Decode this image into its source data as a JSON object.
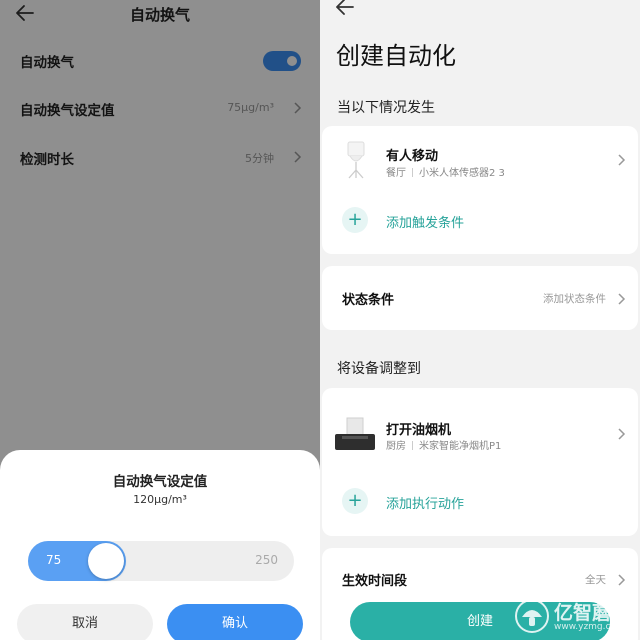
{
  "left": {
    "title": "自动换气",
    "rows": [
      {
        "label": "自动换气",
        "toggle_on": true
      },
      {
        "label": "自动换气设定值",
        "value": "75μg/m³"
      },
      {
        "label": "检测时长",
        "value": "5分钟"
      }
    ],
    "dialog": {
      "title": "自动换气设定值",
      "value": "120μg/m³",
      "slider": {
        "min_label": "75",
        "max_label": "250",
        "min": 75,
        "max": 250,
        "current": 120
      },
      "cancel": "取消",
      "confirm": "确认"
    }
  },
  "right": {
    "title": "创建自动化",
    "section_when": "当以下情况发生",
    "trigger": {
      "name": "有人移动",
      "room": "餐厅",
      "device": "小米人体传感器2 3",
      "icon": "motion-sensor-icon"
    },
    "add_trigger": "添加触发条件",
    "state": {
      "label": "状态条件",
      "value": "添加状态条件"
    },
    "section_action": "将设备调整到",
    "action": {
      "name": "打开油烟机",
      "room": "厨房",
      "device": "米家智能净烟机P1",
      "icon": "range-hood-icon"
    },
    "add_action": "添加执行动作",
    "peek": {
      "label": "生效时间段",
      "value": "全天"
    },
    "create_button": "创建"
  },
  "watermark": {
    "brand": "亿智蘑菇",
    "url": "www.yzmg.com"
  },
  "colors": {
    "blue": "#3b8ff2",
    "teal": "#2ab0a6"
  }
}
